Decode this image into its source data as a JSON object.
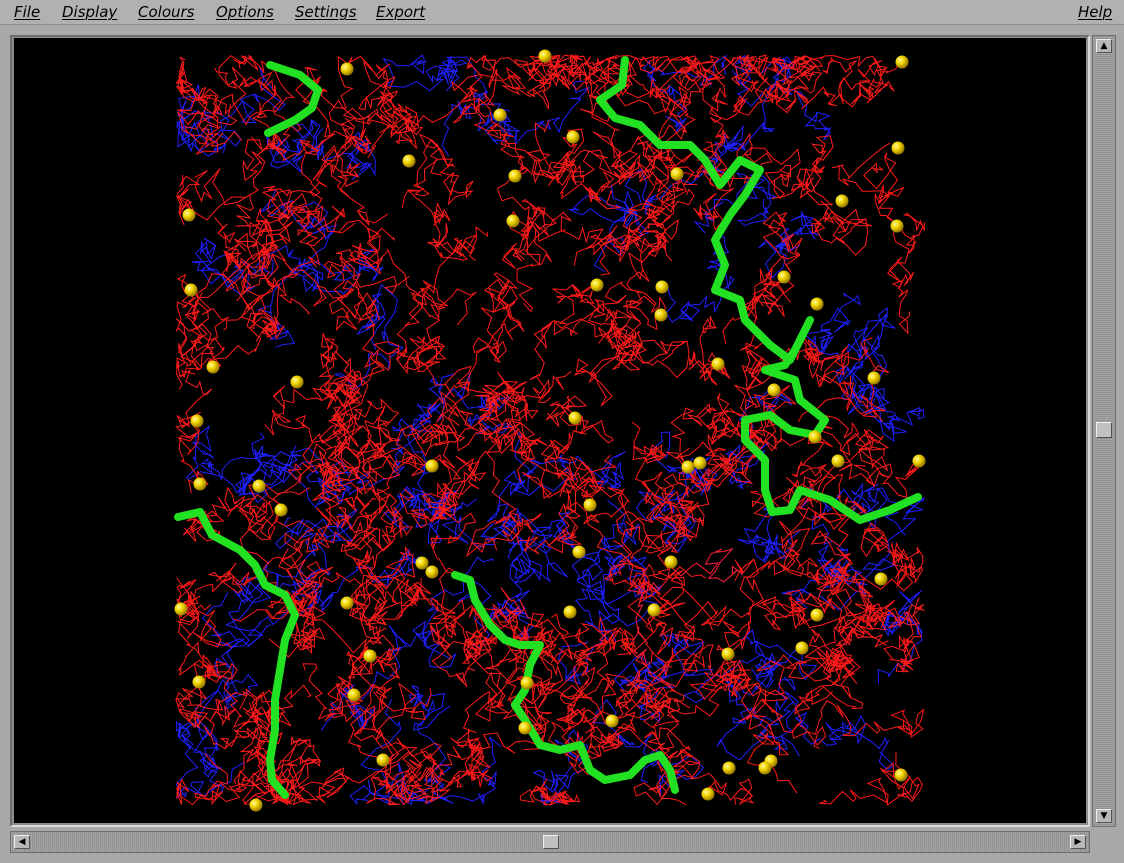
{
  "menubar": {
    "file": "File",
    "display": "Display",
    "colours": "Colours",
    "options": "Options",
    "settings": "Settings",
    "export": "Export",
    "help": "Help"
  },
  "viewer": {
    "colors": {
      "background": "#000000",
      "network_primary": "#ff1a1a",
      "network_secondary": "#2020ff",
      "chains": "#22e022",
      "particles": "#f2d600"
    },
    "icons": {
      "scroll_up": "arrow-up-icon",
      "scroll_down": "arrow-down-icon",
      "scroll_left": "arrow-left-icon",
      "scroll_right": "arrow-right-icon"
    }
  }
}
